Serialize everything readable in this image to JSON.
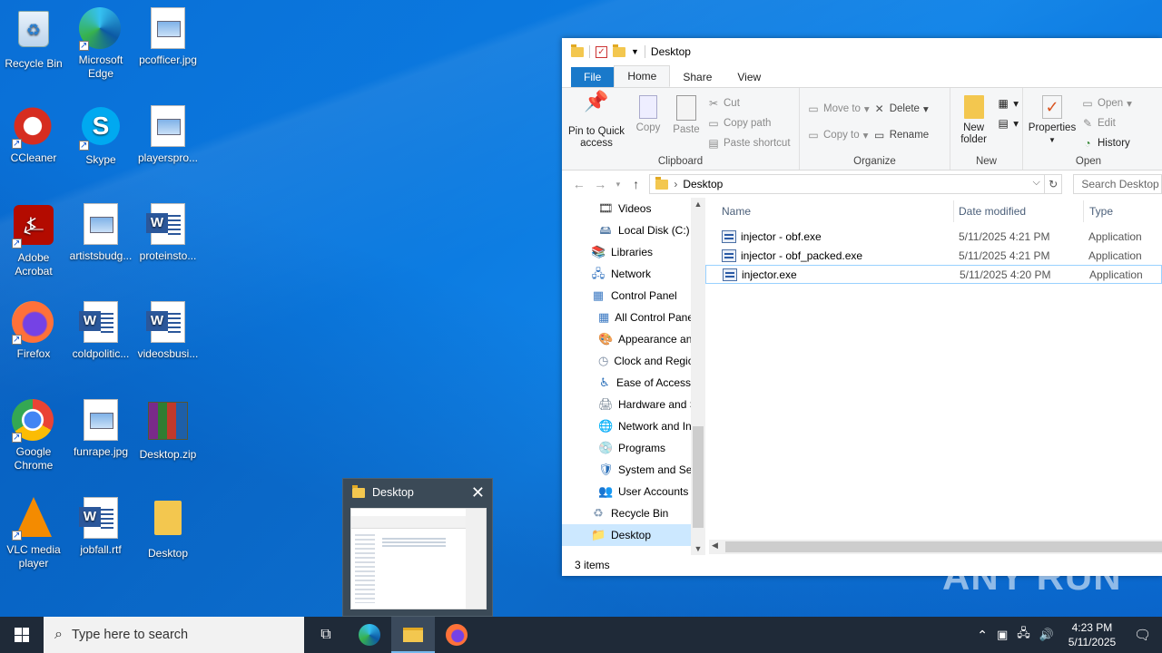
{
  "desktop": {
    "icons": [
      {
        "label": "Recycle Bin"
      },
      {
        "label": "Microsoft Edge"
      },
      {
        "label": "pcofficer.jpg"
      },
      {
        "label": "CCleaner"
      },
      {
        "label": "Skype"
      },
      {
        "label": "playerspro..."
      },
      {
        "label": "Adobe Acrobat"
      },
      {
        "label": "artistsbudg..."
      },
      {
        "label": "proteinsto..."
      },
      {
        "label": "Firefox"
      },
      {
        "label": "coldpolitic..."
      },
      {
        "label": "videosbusi..."
      },
      {
        "label": "Google Chrome"
      },
      {
        "label": "funrape.jpg"
      },
      {
        "label": "Desktop.zip"
      },
      {
        "label": "VLC media player"
      },
      {
        "label": "jobfall.rtf"
      },
      {
        "label": "Desktop"
      }
    ]
  },
  "explorer": {
    "title": "Desktop",
    "tabs": [
      "File",
      "Home",
      "Share",
      "View"
    ],
    "ribbon": {
      "clipboard": {
        "label": "Clipboard",
        "pin": "Pin to Quick access",
        "copy": "Copy",
        "paste": "Paste",
        "cut": "Cut",
        "copy_path": "Copy path",
        "paste_shortcut": "Paste shortcut"
      },
      "organize": {
        "label": "Organize",
        "move_to": "Move to",
        "copy_to": "Copy to",
        "delete": "Delete",
        "rename": "Rename"
      },
      "new": {
        "label": "New",
        "new_folder": "New folder"
      },
      "open": {
        "label": "Open",
        "properties": "Properties",
        "open": "Open",
        "edit": "Edit",
        "history": "History"
      }
    },
    "address": "Desktop",
    "search_placeholder": "Search Desktop",
    "nav_items": [
      {
        "label": "Videos",
        "indent": 2
      },
      {
        "label": "Local Disk (C:)",
        "indent": 2
      },
      {
        "label": "Libraries",
        "indent": 1
      },
      {
        "label": "Network",
        "indent": 1
      },
      {
        "label": "Control Panel",
        "indent": 1
      },
      {
        "label": "All Control Panel Items",
        "indent": 2
      },
      {
        "label": "Appearance and Personalization",
        "indent": 2
      },
      {
        "label": "Clock and Region",
        "indent": 2
      },
      {
        "label": "Ease of Access",
        "indent": 2
      },
      {
        "label": "Hardware and Sound",
        "indent": 2
      },
      {
        "label": "Network and Internet",
        "indent": 2
      },
      {
        "label": "Programs",
        "indent": 2
      },
      {
        "label": "System and Security",
        "indent": 2
      },
      {
        "label": "User Accounts",
        "indent": 2
      },
      {
        "label": "Recycle Bin",
        "indent": 1
      },
      {
        "label": "Desktop",
        "indent": 1
      }
    ],
    "columns": {
      "name": "Name",
      "date": "Date modified",
      "type": "Type"
    },
    "files": [
      {
        "name": "injector - obf.exe",
        "date": "5/11/2025 4:21 PM",
        "type": "Application"
      },
      {
        "name": "injector - obf_packed.exe",
        "date": "5/11/2025 4:21 PM",
        "type": "Application"
      },
      {
        "name": "injector.exe",
        "date": "5/11/2025 4:20 PM",
        "type": "Application"
      }
    ],
    "status": "3 items"
  },
  "preview": {
    "title": "Desktop"
  },
  "taskbar": {
    "search_placeholder": "Type here to search",
    "time": "4:23 PM",
    "date": "5/11/2025"
  },
  "watermark": "ANY RUN"
}
